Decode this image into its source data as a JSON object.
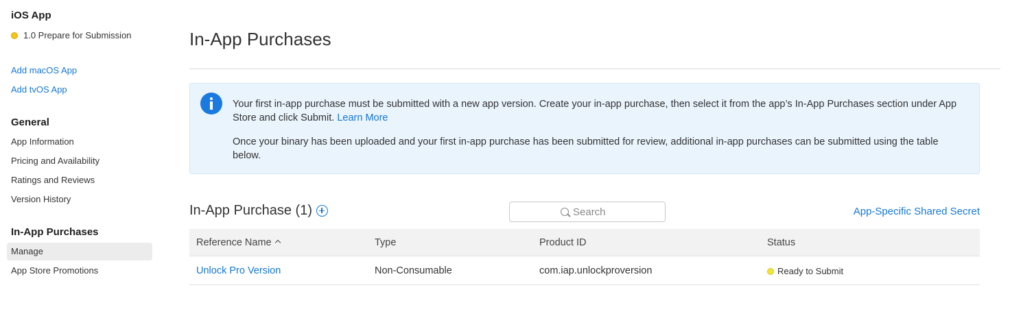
{
  "sidebar": {
    "app_title": "iOS App",
    "version_label": "1.0 Prepare for Submission",
    "add_links": [
      "Add macOS App",
      "Add tvOS App"
    ],
    "general": {
      "heading": "General",
      "items": [
        "App Information",
        "Pricing and Availability",
        "Ratings and Reviews",
        "Version History"
      ]
    },
    "iap": {
      "heading": "In-App Purchases",
      "items": [
        "Manage",
        "App Store Promotions"
      ],
      "selected": "Manage"
    }
  },
  "main": {
    "title": "In-App Purchases",
    "info": {
      "paragraph1": "Your first in-app purchase must be submitted with a new app version. Create your in-app purchase, then select it from the app’s In-App Purchases section under App Store and click Submit.",
      "learn_more": "Learn More",
      "paragraph2": "Once your binary has been uploaded and your first in-app purchase has been submitted for review, additional in-app purchases can be submitted using the table below."
    },
    "section_title": "In-App Purchase (1)",
    "search_placeholder": "Search",
    "secret_link": "App-Specific Shared Secret",
    "table": {
      "columns": [
        "Reference Name",
        "Type",
        "Product ID",
        "Status"
      ],
      "rows": [
        {
          "reference_name": "Unlock Pro Version",
          "type": "Non-Consumable",
          "product_id": "com.iap.unlockproversion",
          "status": "Ready to Submit"
        }
      ]
    }
  },
  "colors": {
    "link": "#1477d4",
    "info_bg": "#eaf4fd",
    "status_ready": "#f3e536",
    "prepare_dot": "#f5c518"
  }
}
